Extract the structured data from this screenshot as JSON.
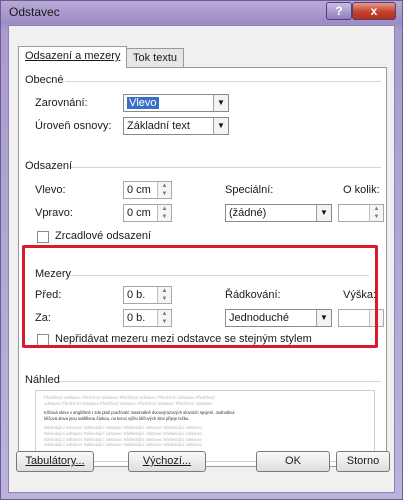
{
  "window": {
    "title": "Odstavec",
    "help_label": "?",
    "close_label": "x"
  },
  "tabs": [
    {
      "label": "Odsazení a mezery",
      "active": true
    },
    {
      "label": "Tok textu",
      "active": false
    }
  ],
  "general": {
    "title": "Obecné",
    "alignment_label": "Zarovnání:",
    "alignment_value": "Vlevo",
    "outline_label": "Úroveň osnovy:",
    "outline_value": "Základní text"
  },
  "indent": {
    "title": "Odsazení",
    "left_label": "Vlevo:",
    "left_value": "0 cm",
    "right_label": "Vpravo:",
    "right_value": "0 cm",
    "special_label": "Speciální:",
    "special_value": "(žádné)",
    "by_label": "O kolik:",
    "by_value": "",
    "mirror_label": "Zrcadlové odsazení"
  },
  "spacing": {
    "title": "Mezery",
    "before_label": "Před:",
    "before_value": "0 b.",
    "after_label": "Za:",
    "after_value": "0 b.",
    "line_label": "Řádkování:",
    "line_value": "Jednoduché",
    "at_label": "Výška:",
    "at_value": "",
    "no_space_label": "Nepřidávat mezeru mezi odstavce se stejným stylem",
    "highlight_color": "#d81b2a"
  },
  "preview": {
    "title": "Náhled",
    "before_lines": [
      "Předchozí odstavec Předchozí odstavec Předchozí odstavec Předchozí odstavec Předchozí",
      "odstavec Předchozí odstavec Předchozí odstavec Předchozí odstavec Předchozí odstavec"
    ],
    "sample_lines": [
      "Klíčová slova v angličtině I zde platí používání maximálně dvouvýrazových slovních spojení. Jednotlivá",
      "klíčová slova jsou oddělena čárkou, na konci výčtu klíčových slov přijeje tečku."
    ],
    "after_lines": [
      "Následující odstavec Následující odstavec Následující odstavec Následující odstavec",
      "Následující odstavec Následující odstavec Následující odstavec Následující odstavec",
      "Následující odstavec Následující odstavec Následující odstavec Následující odstavec",
      "Následující odstavec Následující odstavec Následující odstavec Následující odstavec"
    ]
  },
  "buttons": {
    "tabs": "Tabulátory...",
    "default": "Výchozí...",
    "ok": "OK",
    "cancel": "Storno"
  }
}
